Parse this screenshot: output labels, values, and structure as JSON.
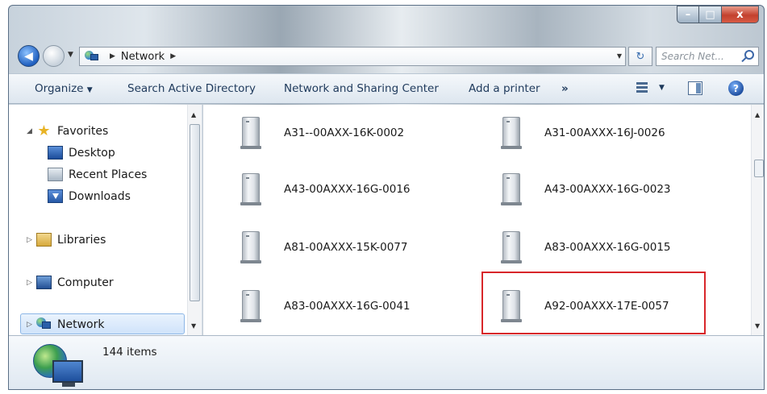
{
  "window": {
    "caption_buttons": {
      "minimize": "–",
      "maximize": "□",
      "close": "x"
    }
  },
  "address": {
    "path": [
      "Network"
    ],
    "search_placeholder": "Search Net..."
  },
  "toolbar": {
    "organize": "Organize",
    "search_ad": "Search Active Directory",
    "network_sharing": "Network and Sharing Center",
    "add_printer": "Add a printer",
    "more": "»"
  },
  "sidebar": {
    "favorites": "Favorites",
    "desktop": "Desktop",
    "recent_places": "Recent Places",
    "downloads": "Downloads",
    "libraries": "Libraries",
    "computer": "Computer",
    "network": "Network"
  },
  "computers": [
    "A31--00AXX-16K-0002",
    "A31-00AXXX-16J-0026",
    "A43-00AXXX-16G-0016",
    "A43-00AXXX-16G-0023",
    "A81-00AXXX-15K-0077",
    "A83-00AXXX-16G-0015",
    "A83-00AXXX-16G-0041",
    "A92-00AXXX-17E-0057"
  ],
  "status": {
    "item_count": "144 items"
  },
  "colors": {
    "highlight_box": "#d8262a",
    "toolbar_text": "#1e395b"
  }
}
